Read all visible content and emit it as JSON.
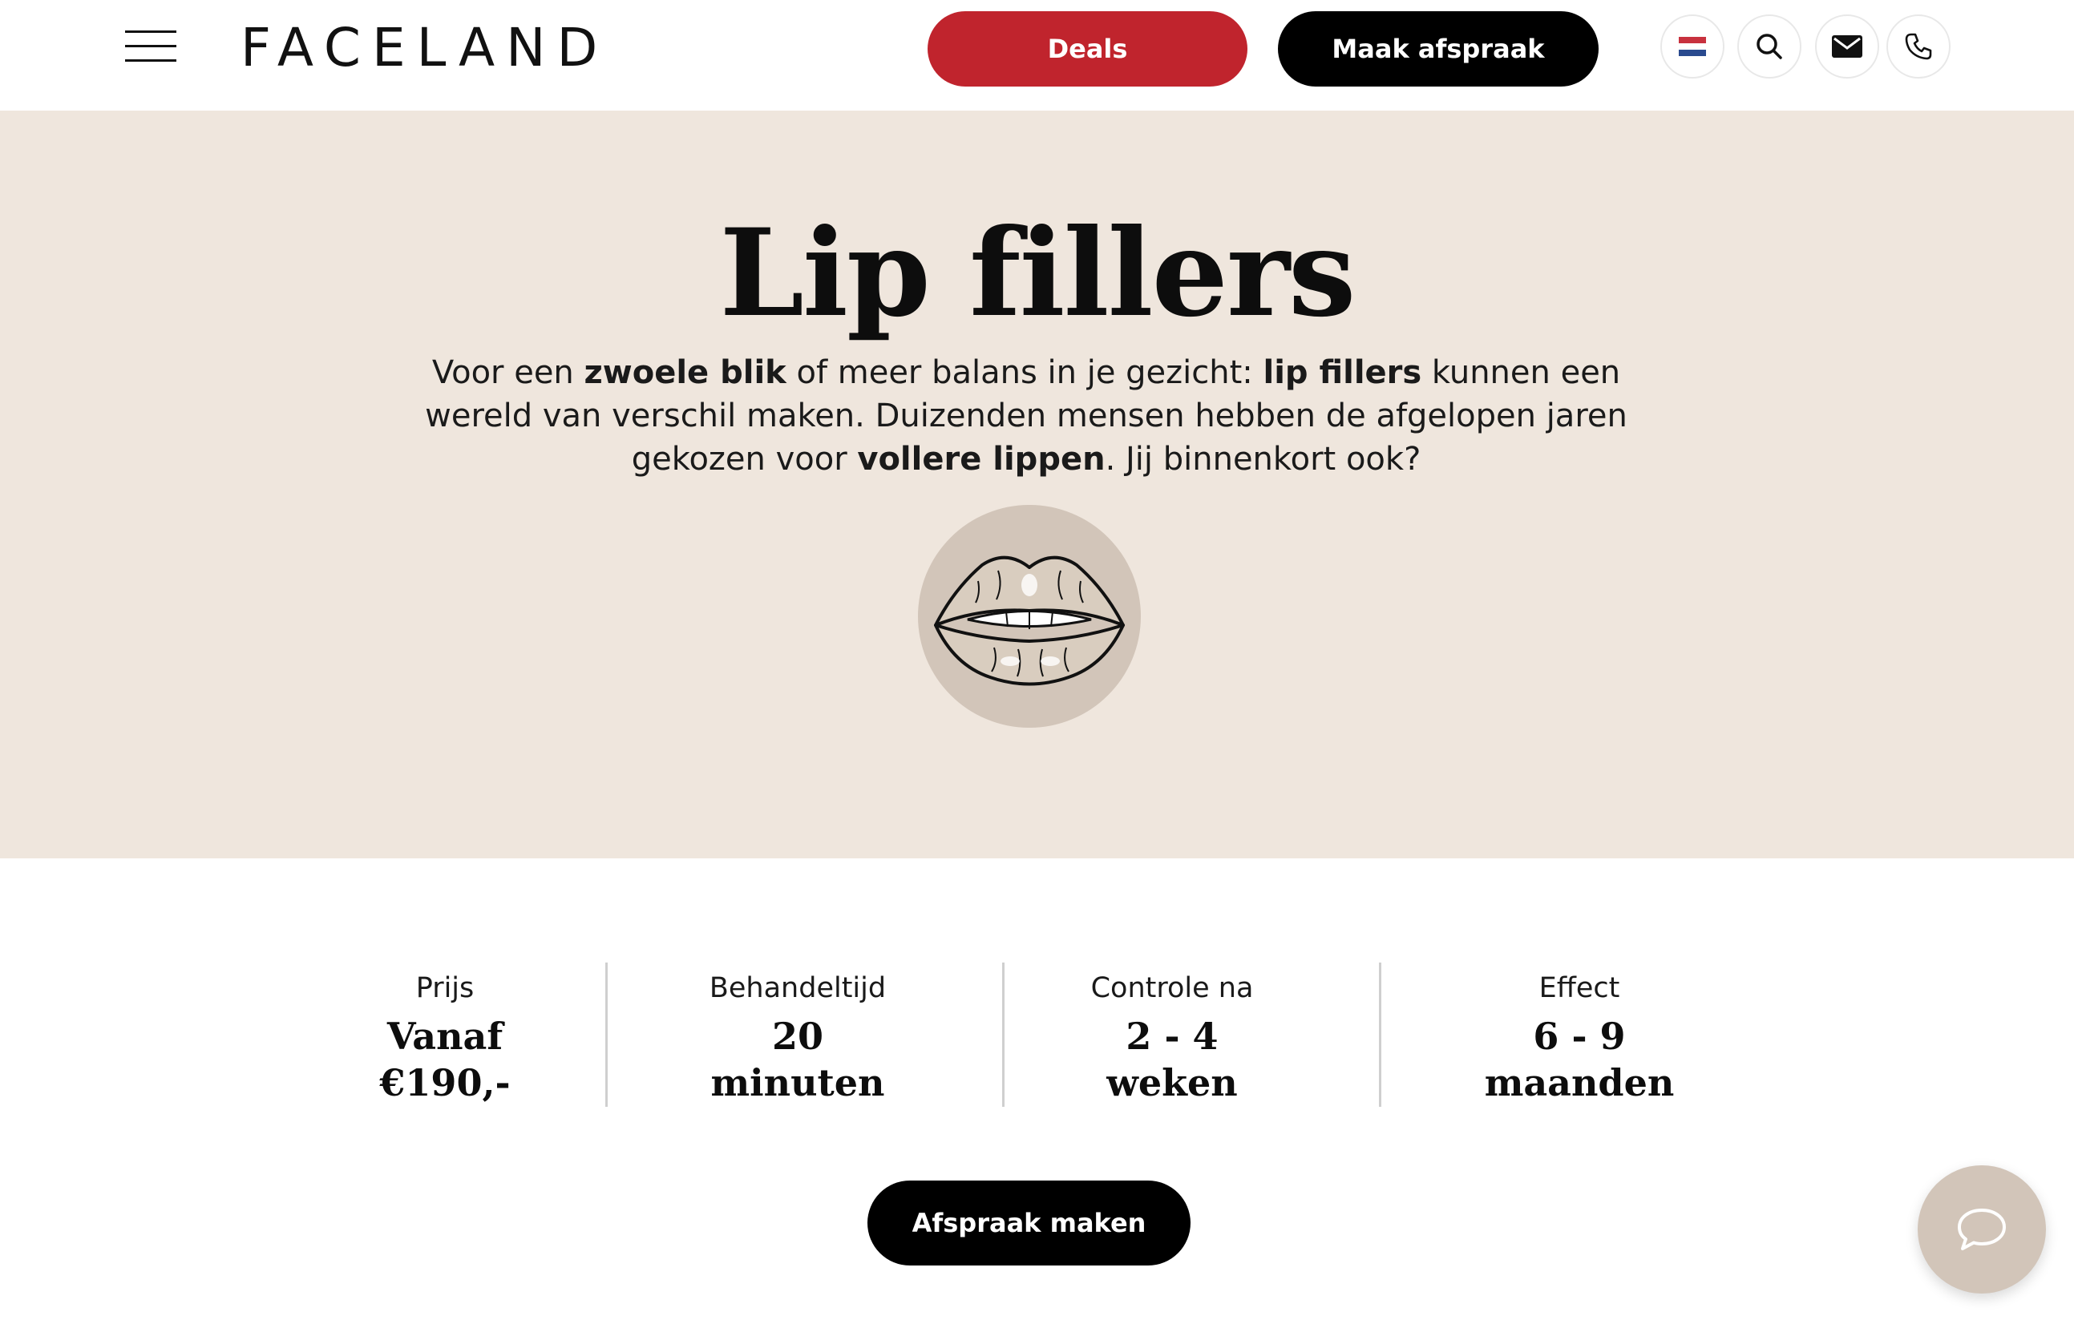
{
  "header": {
    "logo": "FACELAND",
    "deals_label": "Deals",
    "appointment_label": "Maak afspraak",
    "icons": [
      "menu-icon",
      "dutch-flag-icon",
      "search-icon",
      "mail-icon",
      "phone-icon"
    ]
  },
  "hero": {
    "title": "Lip fillers",
    "intro": [
      {
        "text": "Voor een ",
        "bold": false
      },
      {
        "text": "zwoele blik",
        "bold": true
      },
      {
        "text": " of meer balans in je gezicht: ",
        "bold": false
      },
      {
        "text": "lip fillers",
        "bold": true
      },
      {
        "text": " kunnen een wereld van verschil maken. Duizenden mensen hebben de afgelopen jaren gekozen voor ",
        "bold": false
      },
      {
        "text": "vollere lippen",
        "bold": true
      },
      {
        "text": ". Jij binnenkort ook?",
        "bold": false
      }
    ],
    "illustration": "lips-icon"
  },
  "facts": [
    {
      "label": "Prijs",
      "value_line1": "Vanaf",
      "value_line2": "€190,-"
    },
    {
      "label": "Behandeltijd",
      "value_line1": "20",
      "value_line2": "minuten"
    },
    {
      "label": "Controle na",
      "value_line1": "2 - 4",
      "value_line2": "weken"
    },
    {
      "label": "Effect",
      "value_line1": "6 - 9",
      "value_line2": "maanden"
    }
  ],
  "cta": {
    "label": "Afspraak maken"
  },
  "chat": {
    "icon": "chat-bubble-icon"
  },
  "colors": {
    "deals": "#c0242d",
    "primary": "#000000",
    "hero_bg": "#efe6dd",
    "accent_circle": "#d2c5b9"
  }
}
